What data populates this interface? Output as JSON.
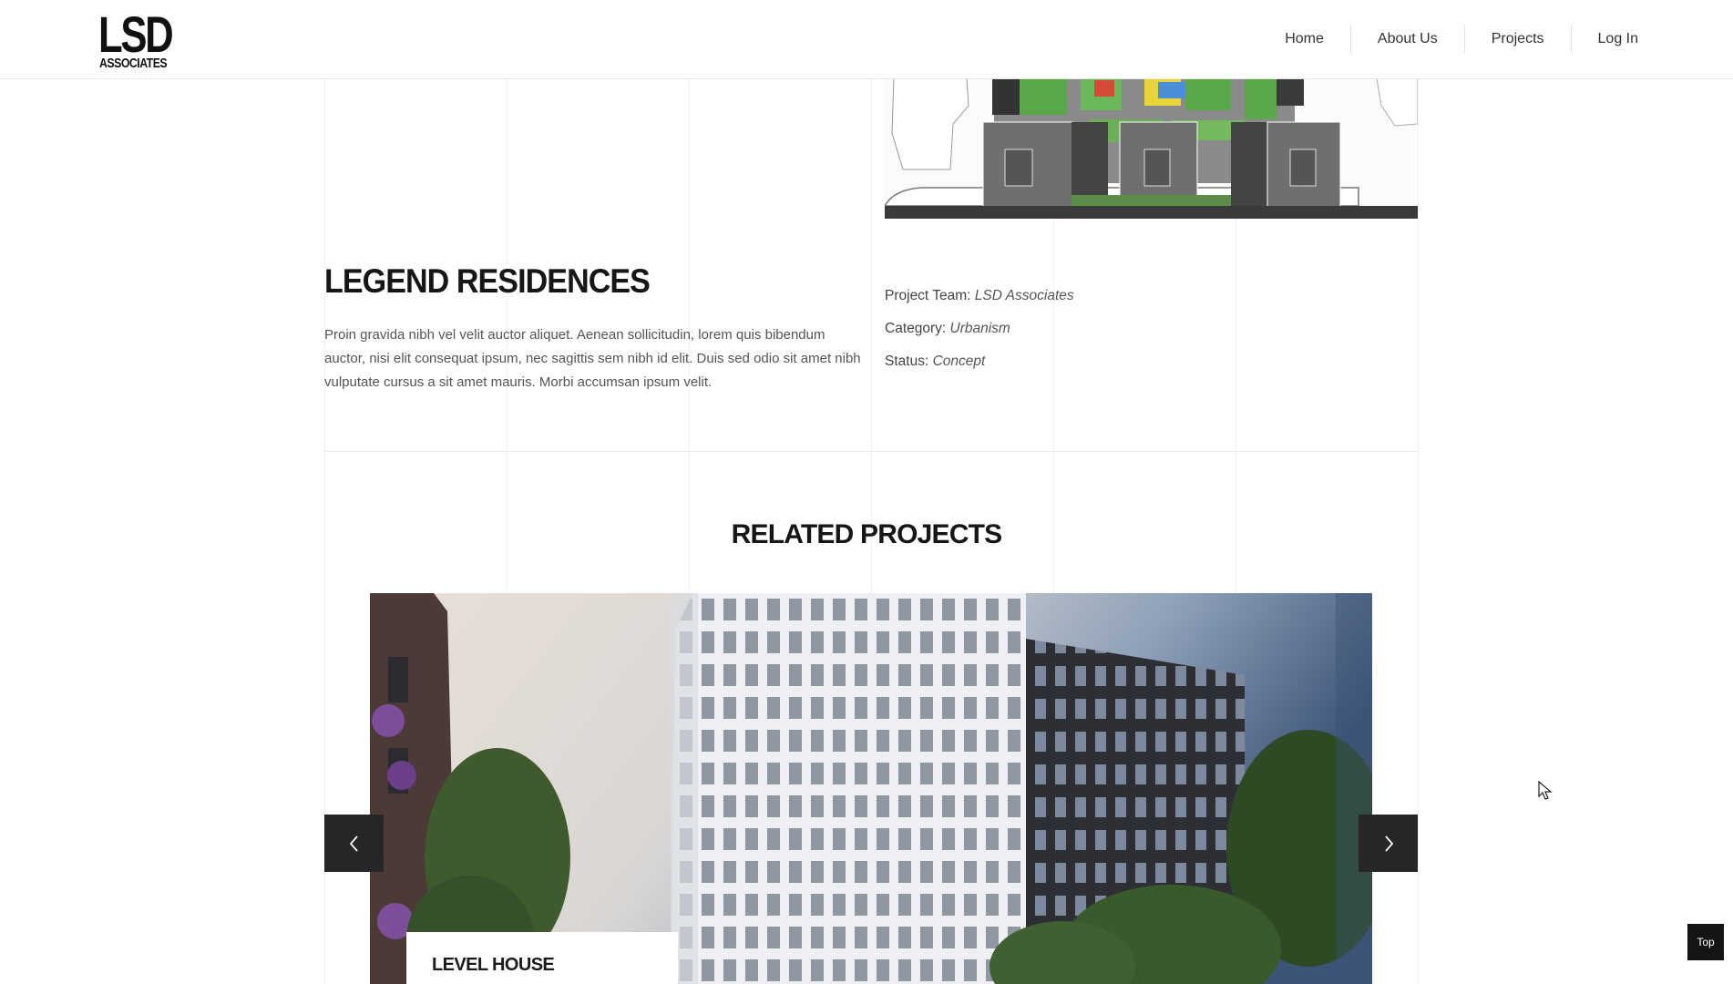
{
  "header": {
    "logo": {
      "main": "LSD",
      "sub": "ASSOCIATES"
    },
    "nav": [
      {
        "label": "Home"
      },
      {
        "label": "About Us"
      },
      {
        "label": "Projects"
      },
      {
        "label": "Log In"
      }
    ]
  },
  "project": {
    "title": "LEGEND RESIDENCES",
    "description": "Proin gravida nibh vel velit auctor aliquet. Aenean sollicitudin, lorem quis bibendum auctor, nisi elit consequat ipsum, nec sagittis sem nibh id elit. Duis sed odio sit amet nibh vulputate cursus a sit amet mauris. Morbi accumsan ipsum velit.",
    "meta": [
      {
        "label": "Project Team:",
        "value": "LSD Associates"
      },
      {
        "label": "Category:",
        "value": "Urbanism"
      },
      {
        "label": "Status:",
        "value": "Concept"
      }
    ]
  },
  "related": {
    "heading": "RELATED PROJECTS",
    "slides": [
      {
        "title": "LEVEL HOUSE"
      }
    ]
  },
  "back_to_top": {
    "label": "Top"
  },
  "colors": {
    "text_dark": "#161616",
    "arrow_bg": "#262626",
    "top_btn_bg": "#141414",
    "grid_line": "#f1f1f1"
  },
  "icons": [
    "chevron-left-icon",
    "chevron-right-icon",
    "mouse-cursor-icon"
  ]
}
